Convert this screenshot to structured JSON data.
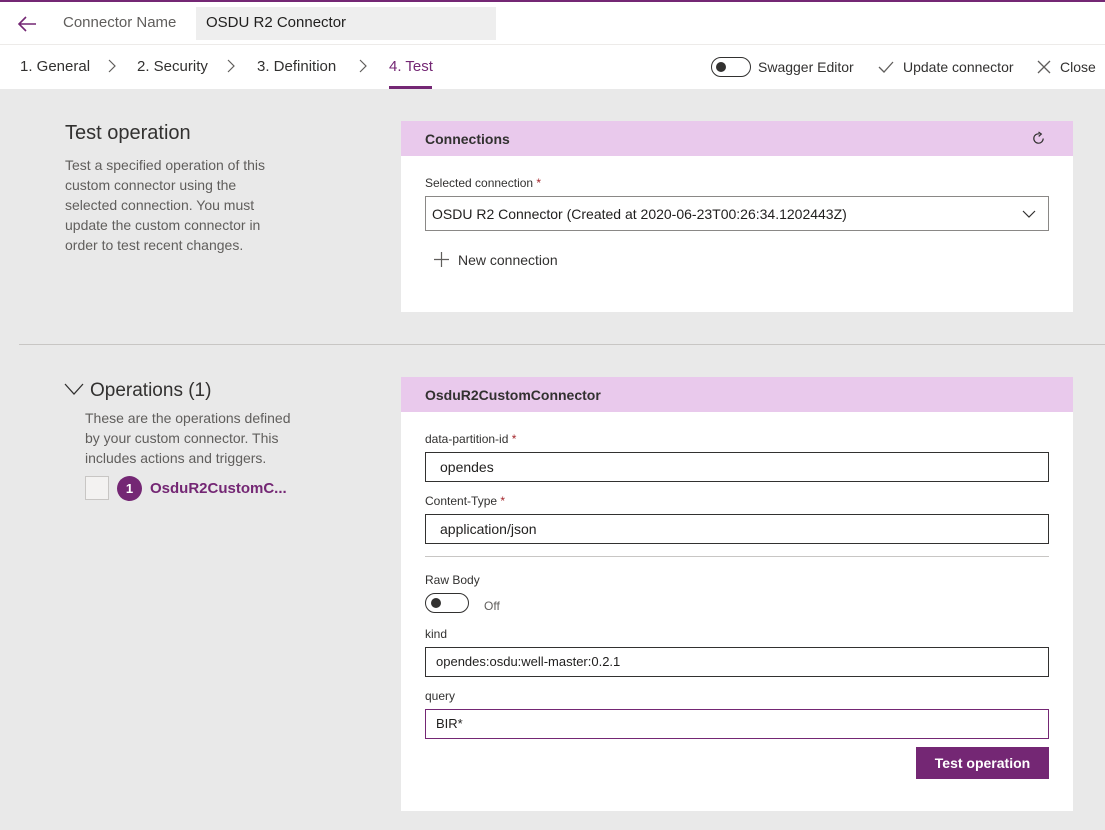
{
  "header": {
    "connector_name_label": "Connector Name",
    "connector_name_value": "OSDU R2 Connector"
  },
  "tabs": [
    {
      "label": "1. General"
    },
    {
      "label": "2. Security"
    },
    {
      "label": "3. Definition"
    },
    {
      "label": "4. Test"
    }
  ],
  "toolbar": {
    "swagger_label": "Swagger Editor",
    "update_label": "Update connector",
    "close_label": "Close"
  },
  "test_section": {
    "title": "Test operation",
    "description_lines": [
      "Test a specified operation of this",
      "custom connector using the",
      "selected connection. You must",
      "update the custom connector in",
      "order to test recent changes."
    ]
  },
  "connections_card": {
    "header": "Connections",
    "selected_label": "Selected connection",
    "selected_value": "OSDU R2 Connector (Created at 2020-06-23T00:26:34.1202443Z)",
    "new_connection_label": "New connection"
  },
  "operations_section": {
    "title": "Operations (1)",
    "description_lines": [
      "These are the operations defined",
      "by your custom connector. This",
      "includes actions and triggers."
    ],
    "item_number": "1",
    "item_name": "OsduR2CustomC..."
  },
  "operation_card": {
    "header": "OsduR2CustomConnector",
    "partition_label": "data-partition-id",
    "partition_value": "opendes",
    "content_type_label": "Content-Type",
    "content_type_value": "application/json",
    "raw_body_label": "Raw Body",
    "raw_body_state": "Off",
    "kind_label": "kind",
    "kind_value": "opendes:osdu:well-master:0.2.1",
    "query_label": "query",
    "query_value": "BIR*",
    "test_button_label": "Test operation"
  },
  "colors": {
    "accent": "#742774",
    "card_header": "#e9c9ec",
    "page_background": "#e9e9e9"
  },
  "icons": [
    "back-arrow-icon",
    "chevron-right-icon",
    "checkmark-icon",
    "close-icon",
    "refresh-icon",
    "chevron-down-icon",
    "plus-icon"
  ]
}
